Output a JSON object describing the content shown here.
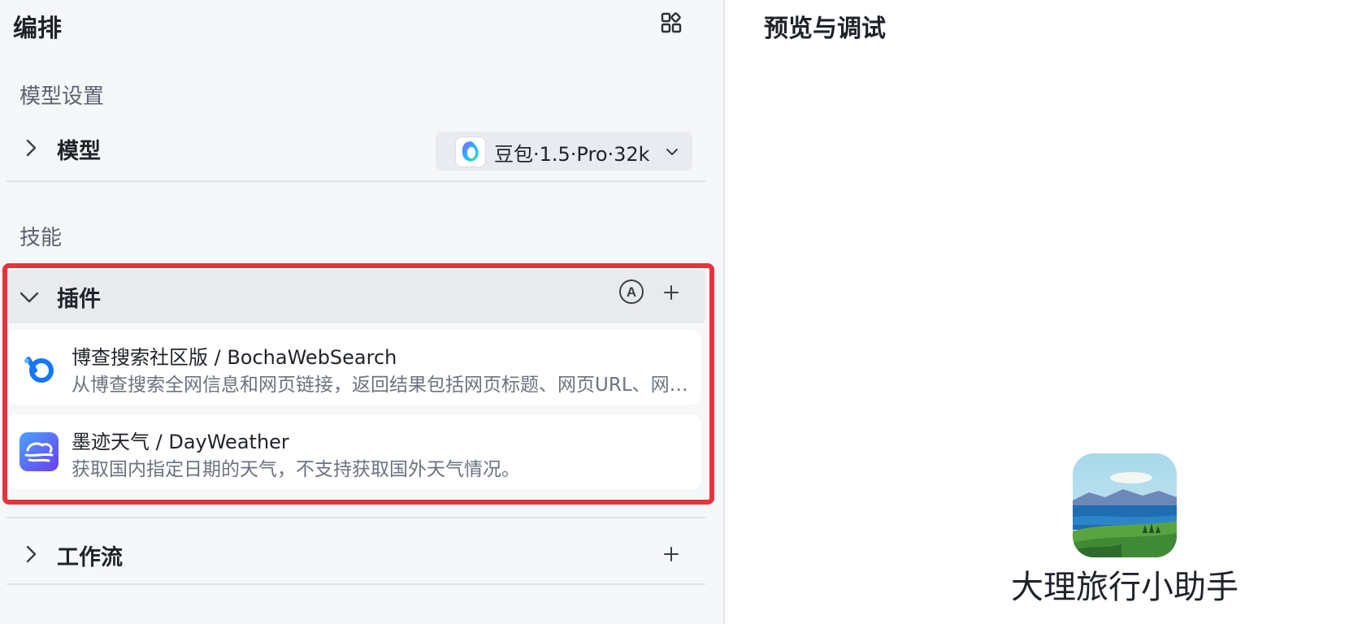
{
  "left": {
    "title": "编排",
    "model_section": {
      "label": "模型设置",
      "row_label": "模型",
      "selected_model": "豆包·1.5·Pro·32k"
    },
    "skills_section": {
      "label": "技能",
      "plugins": {
        "label": "插件",
        "items": [
          {
            "name": "博查搜索社区版 / BochaWebSearch",
            "desc": "从博查搜索全网信息和网页链接，返回结果包括网页标题、网页URL、网页摘要等信息",
            "icon": "bocha-logo-icon"
          },
          {
            "name": "墨迹天气 / DayWeather",
            "desc": "获取国内指定日期的天气，不支持获取国外天气情况。",
            "icon": "moji-weather-icon"
          }
        ]
      },
      "workflow_label": "工作流"
    },
    "highlight_color": "#e8323c"
  },
  "right": {
    "title": "预览与调试",
    "bot_name": "大理旅行小助手"
  }
}
